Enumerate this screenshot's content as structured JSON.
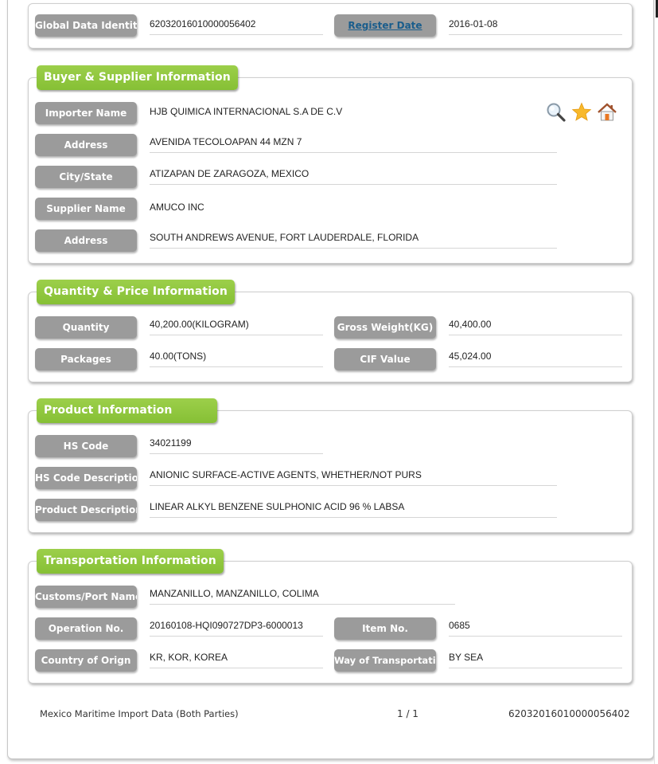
{
  "header": {
    "global_data_identity_label": "Global Data Identity",
    "global_data_identity_value": "62032016010000056402",
    "register_date_label": "Register Date",
    "register_date_value": "2016-01-08"
  },
  "buyer_supplier": {
    "title": "Buyer & Supplier Information",
    "icons": [
      "search-icon",
      "star-icon",
      "home-icon"
    ],
    "rows": [
      {
        "label": "Importer Name",
        "value": "HJB QUIMICA INTERNACIONAL S.A DE C.V"
      },
      {
        "label": "Address",
        "value": "AVENIDA TECOLOAPAN 44 MZN 7"
      },
      {
        "label": "City/State",
        "value": "ATIZAPAN DE ZARAGOZA, MEXICO"
      },
      {
        "label": "Supplier Name",
        "value": "AMUCO INC"
      },
      {
        "label": "Address",
        "value": "SOUTH ANDREWS AVENUE, FORT LAUDERDALE, FLORIDA"
      }
    ]
  },
  "quantity_price": {
    "title": "Quantity & Price Information",
    "quantity_label": "Quantity",
    "quantity_value": "40,200.00(KILOGRAM)",
    "gross_weight_label": "Gross Weight(KG)",
    "gross_weight_value": "40,400.00",
    "packages_label": "Packages",
    "packages_value": "40.00(TONS)",
    "cif_value_label": "CIF Value",
    "cif_value_value": "45,024.00"
  },
  "product": {
    "title": "Product Information",
    "hs_code_label": "HS Code",
    "hs_code_value": "34021199",
    "hs_desc_label": "HS Code Description",
    "hs_desc_value": "ANIONIC SURFACE-ACTIVE AGENTS, WHETHER/NOT PURS",
    "product_desc_label": "Product Description",
    "product_desc_value": "LINEAR ALKYL BENZENE SULPHONIC ACID 96 % LABSA"
  },
  "transportation": {
    "title": "Transportation Information",
    "port_label": "Customs/Port Name",
    "port_value": "MANZANILLO, MANZANILLO, COLIMA",
    "operation_label": "Operation No.",
    "operation_value": "20160108-HQI090727DP3-6000013",
    "item_label": "Item No.",
    "item_value": "0685",
    "origin_label": "Country of Orign",
    "origin_value": "KR, KOR, KOREA",
    "way_label": "Way of Transportation",
    "way_value": "BY SEA"
  },
  "footer": {
    "source": "Mexico Maritime Import Data (Both Parties)",
    "page": "1 / 1",
    "id": "62032016010000056402"
  }
}
